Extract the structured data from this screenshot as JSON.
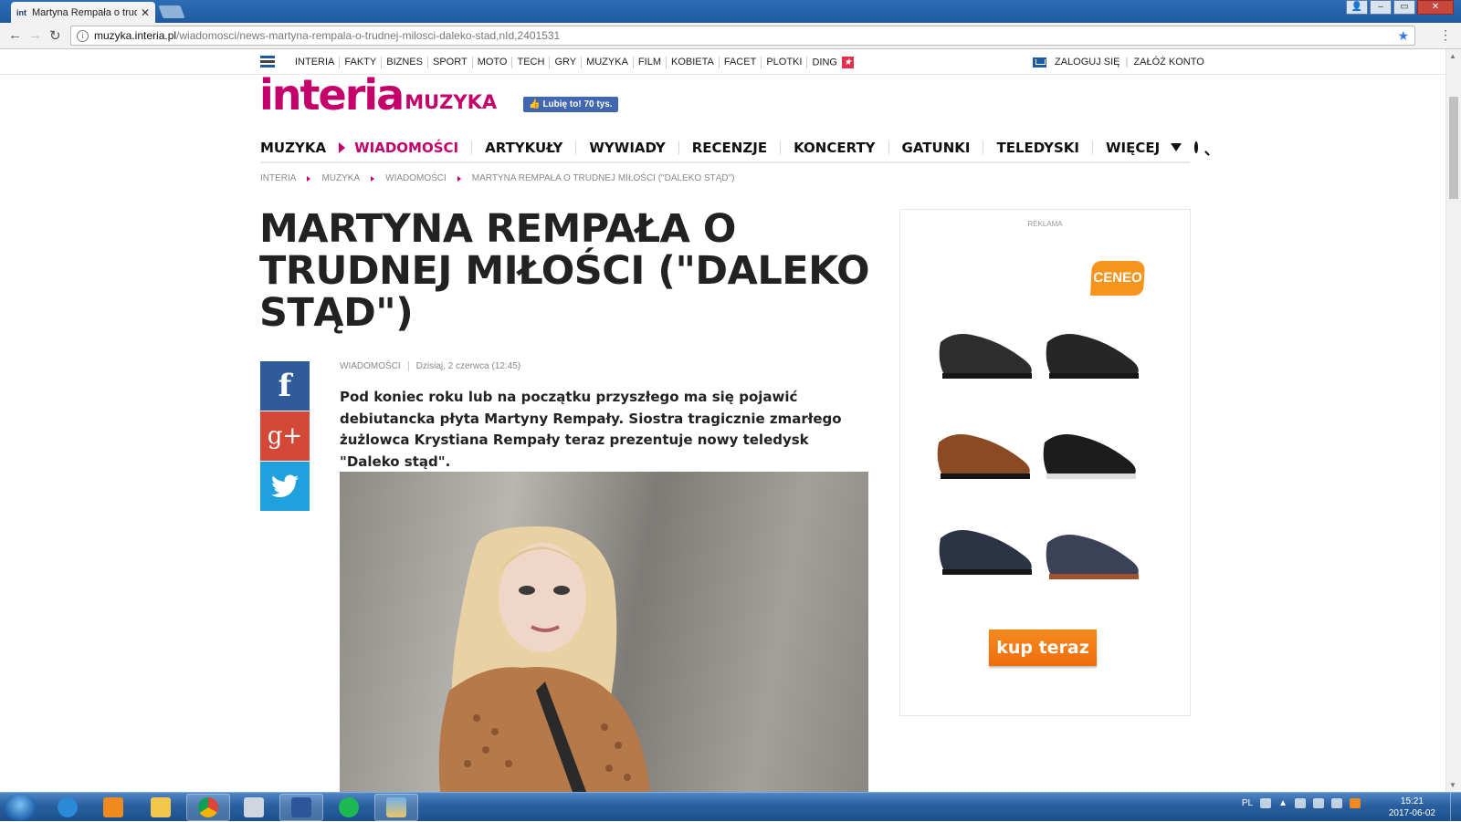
{
  "browser": {
    "tab_title": "Martyna Rempała o trud",
    "tab_favicon": "int",
    "url_domain": "muzyka.interia.pl",
    "url_path": "/wiadomosci/news-martyna-rempala-o-trudnej-milosci-daleko-stad,nId,2401531"
  },
  "portal": {
    "links": [
      "INTERIA",
      "FAKTY",
      "BIZNES",
      "SPORT",
      "MOTO",
      "TECH",
      "GRY",
      "MUZYKA",
      "FILM",
      "KOBIETA",
      "FACET",
      "PLOTKI",
      "DING"
    ],
    "login": "ZALOGUJ SIĘ",
    "register": "ZAŁÓŻ KONTO"
  },
  "site": {
    "brand": "interia",
    "section": "MUZYKA",
    "fb_like": "Lubię to! 70 tys."
  },
  "mainnav": {
    "home": "MUZYKA",
    "items": [
      "WIADOMOŚCI",
      "ARTYKUŁY",
      "WYWIADY",
      "RECENZJE",
      "KONCERTY",
      "GATUNKI",
      "TELEDYSKI",
      "WIĘCEJ"
    ],
    "active": "WIADOMOŚCI"
  },
  "breadcrumb": [
    "INTERIA",
    "MUZYKA",
    "WIADOMOŚCI",
    "MARTYNA REMPAŁA O TRUDNEJ MIŁOŚCI (\"DALEKO STĄD\")"
  ],
  "article": {
    "title": "MARTYNA REMPAŁA O TRUDNEJ MIŁOŚCI (\"DALEKO STĄD\")",
    "category": "WIADOMOŚCI",
    "date": "Dzisiaj, 2 czerwca (12:45)",
    "lead": "Pod koniec roku lub na początku przyszłego ma się pojawić debiutancka płyta Martyny Rempały. Siostra tragicznie zmarłego żużlowca Krystiana Rempały teraz prezentuje nowy teledysk \"Daleko stąd\"."
  },
  "share": {
    "facebook": "f",
    "googleplus": "g+"
  },
  "ad": {
    "label": "REKLAMA",
    "brand": "CENEO",
    "cta": "kup teraz",
    "shoes": [
      "#2e2e2e",
      "#262626",
      "#8a4a24",
      "#1c1c1c",
      "#2b3344",
      "#3b4258"
    ]
  },
  "taskbar": {
    "time": "15:21",
    "date": "2017-06-02",
    "lang": "PL"
  },
  "colors": {
    "brand": "#c4006a",
    "facebook": "#2f5b9b",
    "googleplus": "#d34836",
    "twitter": "#1ea1dd",
    "cta": "#f58a1f"
  }
}
